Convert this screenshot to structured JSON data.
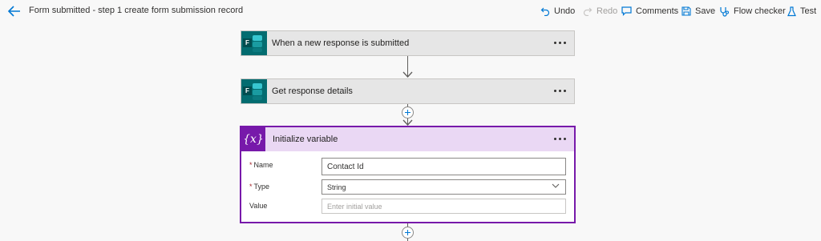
{
  "header": {
    "title": "Form submitted - step 1 create form submission record",
    "undo_label": "Undo",
    "redo_label": "Redo",
    "comments_label": "Comments",
    "save_label": "Save",
    "flow_checker_label": "Flow checker",
    "test_label": "Test"
  },
  "steps": [
    {
      "title": "When a new response is submitted",
      "icon": "microsoft-forms-icon"
    },
    {
      "title": "Get response details",
      "icon": "microsoft-forms-icon"
    }
  ],
  "init_variable": {
    "title": "Initialize variable",
    "icon_text": "{x}",
    "name_label": "Name",
    "name_value": "Contact Id",
    "type_label": "Type",
    "type_value": "String",
    "value_label": "Value",
    "value_placeholder": "Enter initial value",
    "required_marker": "*"
  },
  "colors": {
    "accent_blue": "#0078d4",
    "variable_purple": "#7719aa",
    "forms_teal": "#036c70"
  }
}
